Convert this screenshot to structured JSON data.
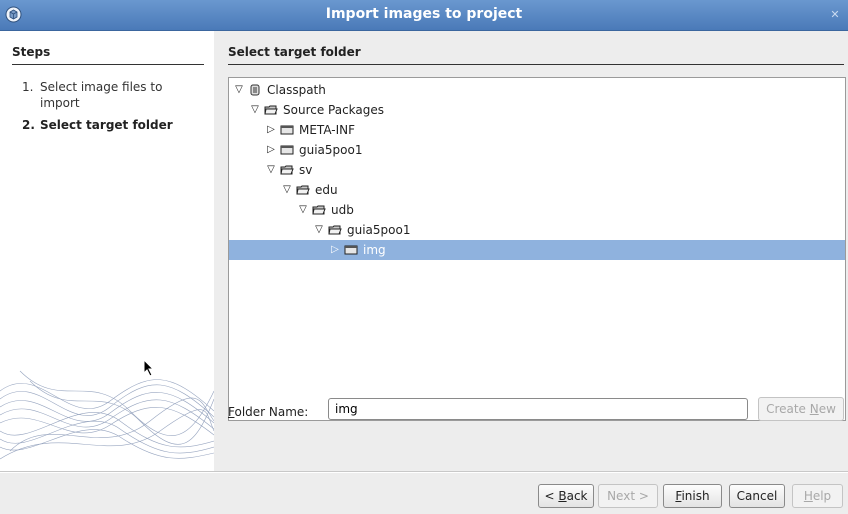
{
  "window": {
    "title": "Import images to project",
    "close_glyph": "✕",
    "icon": "netbeans-cube-icon"
  },
  "steps": {
    "heading": "Steps",
    "items": [
      {
        "num": "1.",
        "label": "Select image files to import"
      },
      {
        "num": "2.",
        "label": "Select target folder"
      }
    ]
  },
  "main": {
    "heading": "Select target folder",
    "tree": [
      {
        "label": "Classpath",
        "expanded": true,
        "depth": 0,
        "selected": false,
        "icon": "classpath-icon"
      },
      {
        "label": "Source Packages",
        "expanded": true,
        "depth": 1,
        "selected": false,
        "icon": "folder-open-icon"
      },
      {
        "label": "META-INF",
        "expanded": false,
        "depth": 2,
        "selected": false,
        "icon": "folder-icon"
      },
      {
        "label": "guia5poo1",
        "expanded": false,
        "depth": 2,
        "selected": false,
        "icon": "folder-icon"
      },
      {
        "label": "sv",
        "expanded": true,
        "depth": 2,
        "selected": false,
        "icon": "folder-open-icon"
      },
      {
        "label": "edu",
        "expanded": true,
        "depth": 3,
        "selected": false,
        "icon": "folder-open-icon"
      },
      {
        "label": "udb",
        "expanded": true,
        "depth": 4,
        "selected": false,
        "icon": "folder-open-icon"
      },
      {
        "label": "guia5poo1",
        "expanded": true,
        "depth": 5,
        "selected": false,
        "icon": "folder-open-icon"
      },
      {
        "label": "img",
        "expanded": false,
        "depth": 6,
        "selected": true,
        "icon": "folder-icon"
      }
    ],
    "folder_name_label_first": "F",
    "folder_name_label_rest": "older Name:",
    "folder_name_value": "img",
    "create_new_label_pre": "Create ",
    "create_new_label_u": "N",
    "create_new_label_post": "ew"
  },
  "buttons": {
    "back_pre": "< ",
    "back_u": "B",
    "back_post": "ack",
    "next": "Next >",
    "finish_u": "F",
    "finish_post": "inish",
    "cancel": "Cancel",
    "help_u": "H",
    "help_post": "elp"
  }
}
